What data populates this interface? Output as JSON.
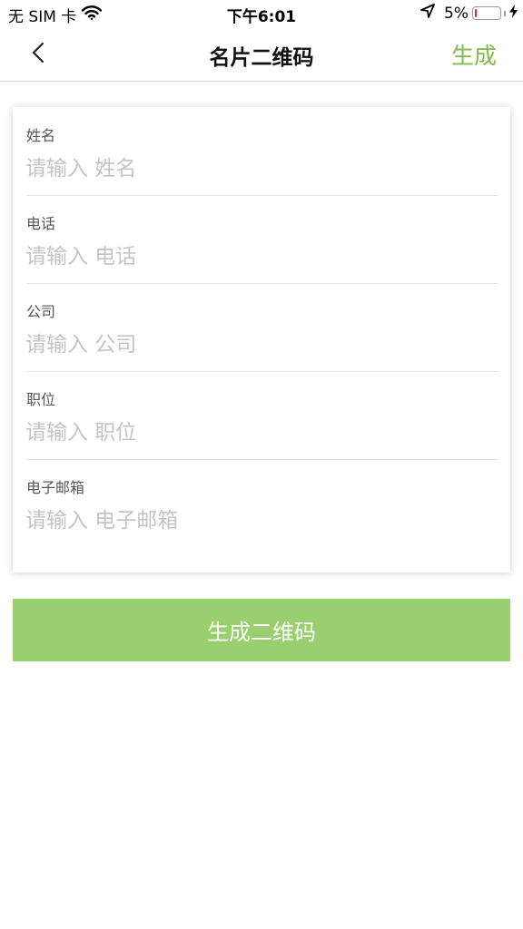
{
  "status_bar": {
    "carrier": "无 SIM 卡",
    "time": "下午6:01",
    "battery_percent": "5%",
    "battery_level": 0.05,
    "icons": [
      "wifi-icon",
      "location-arrow-icon",
      "battery-icon",
      "charging-bolt-icon"
    ]
  },
  "nav": {
    "back_icon": "chevron-left-icon",
    "title": "名片二维码",
    "action_label": "生成"
  },
  "form": {
    "fields": [
      {
        "label": "姓名",
        "placeholder": "请输入 姓名",
        "value": ""
      },
      {
        "label": "电话",
        "placeholder": "请输入 电话",
        "value": ""
      },
      {
        "label": "公司",
        "placeholder": "请输入 公司",
        "value": ""
      },
      {
        "label": "职位",
        "placeholder": "请输入 职位",
        "value": ""
      },
      {
        "label": "电子邮箱",
        "placeholder": "请输入 电子邮箱",
        "value": ""
      }
    ]
  },
  "generate_button": {
    "label": "生成二维码"
  },
  "colors": {
    "accent": "#7fba4c",
    "button_bg": "#99cf6f",
    "placeholder": "#c4c4c4",
    "battery_low": "#e0222b"
  }
}
